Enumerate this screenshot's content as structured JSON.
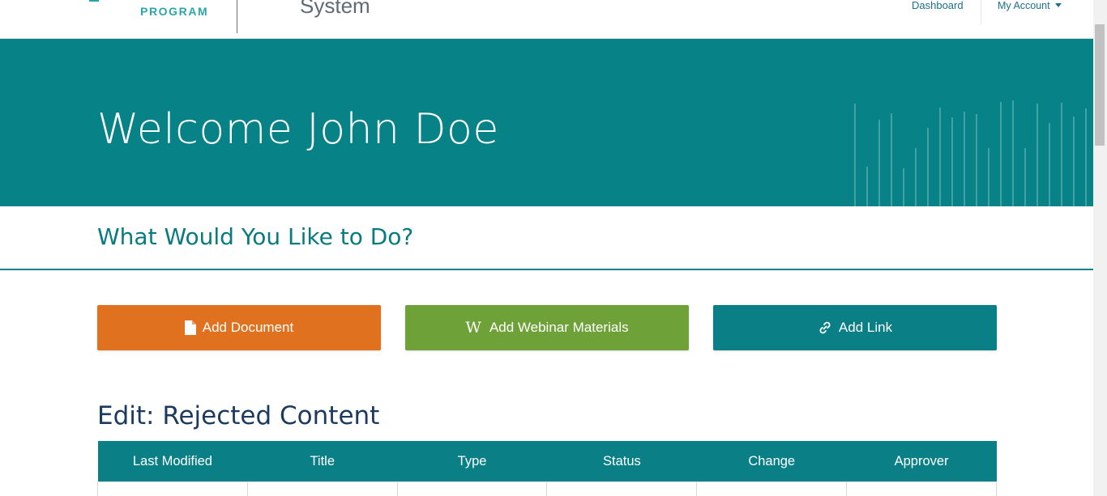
{
  "header": {
    "logo_text": "PROGRAM",
    "system_title": "System",
    "nav": {
      "dashboard": "Dashboard",
      "my_account": "My Account"
    }
  },
  "hero": {
    "welcome": "Welcome John Doe"
  },
  "actions": {
    "heading": "What Would You Like to Do?",
    "add_document": "Add Document",
    "add_webinar": "Add Webinar Materials",
    "add_link": "Add Link",
    "webinar_glyph": "W"
  },
  "rejected": {
    "title": "Edit: Rejected Content",
    "columns": [
      "Last Modified",
      "Title",
      "Type",
      "Status",
      "Change",
      "Approver"
    ]
  },
  "colors": {
    "teal": "#078287",
    "orange": "#e0711f",
    "green": "#6fa139",
    "navy": "#1c3a5e"
  },
  "icons": {
    "add_document": "document-icon",
    "add_webinar": "wikipedia-w-icon",
    "add_link": "link-icon",
    "my_account": "caret-down-icon"
  }
}
